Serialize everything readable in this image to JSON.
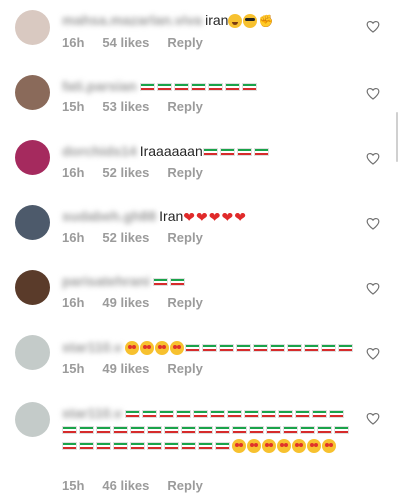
{
  "comments": [
    {
      "username": "mahsa.mazarlan.viva",
      "text": "iran",
      "emoji": [
        "grin",
        "cool",
        "arm"
      ],
      "time": "16h",
      "likes": "54 likes",
      "reply": "Reply",
      "avatar_color": "#d9c9c1"
    },
    {
      "username": "fati.parsian",
      "text": "",
      "emoji": [
        "flag",
        "flag",
        "flag",
        "flag",
        "flag",
        "flag",
        "flag"
      ],
      "time": "15h",
      "likes": "53 likes",
      "reply": "Reply",
      "avatar_color": "#8a6a5a"
    },
    {
      "username": "dorchids14",
      "text": "Iraaaaaan",
      "emoji": [
        "flag",
        "flag",
        "flag",
        "flag"
      ],
      "time": "16h",
      "likes": "52 likes",
      "reply": "Reply",
      "avatar_color": "#a52a5e"
    },
    {
      "username": "sudabeh.gh88",
      "text": "Iran",
      "emoji": [
        "heart",
        "heart",
        "heart",
        "heart",
        "heart"
      ],
      "time": "16h",
      "likes": "52 likes",
      "reply": "Reply",
      "avatar_color": "#4d5a6b"
    },
    {
      "username": "parisatehrani",
      "text": "",
      "emoji": [
        "flag",
        "flag"
      ],
      "time": "16h",
      "likes": "49 likes",
      "reply": "Reply",
      "avatar_color": "#5a3b2a"
    },
    {
      "username": "star110.v",
      "text": "",
      "emoji": [
        "hearteyes",
        "hearteyes",
        "hearteyes",
        "hearteyes",
        "flag",
        "flag",
        "flag",
        "flag",
        "flag",
        "flag",
        "flag",
        "flag",
        "flag",
        "flag"
      ],
      "time": "15h",
      "likes": "49 likes",
      "reply": "Reply",
      "avatar_color": "#c4cbc9"
    },
    {
      "username": "star110.v",
      "text": "",
      "emoji": [
        "flag",
        "flag",
        "flag",
        "flag",
        "flag",
        "flag",
        "flag",
        "flag",
        "flag",
        "flag",
        "flag",
        "flag",
        "flag",
        "flag",
        "flag",
        "flag",
        "flag",
        "flag",
        "flag",
        "flag",
        "flag",
        "flag",
        "flag",
        "flag",
        "flag",
        "flag",
        "flag",
        "flag",
        "flag",
        "flag",
        "flag",
        "flag",
        "flag",
        "flag",
        "flag",
        "flag",
        "flag",
        "flag",
        "flag",
        "flag",
        "hearteyes",
        "hearteyes",
        "hearteyes",
        "hearteyes",
        "hearteyes",
        "hearteyes",
        "hearteyes"
      ],
      "time": "15h",
      "likes": "46 likes",
      "reply": "Reply",
      "avatar_color": "#c4cbc9"
    }
  ],
  "colors": {
    "meta": "#9b9b9b",
    "heart_outline": "#6e6e6e"
  },
  "icons": {
    "like": "heart-outline-icon"
  }
}
